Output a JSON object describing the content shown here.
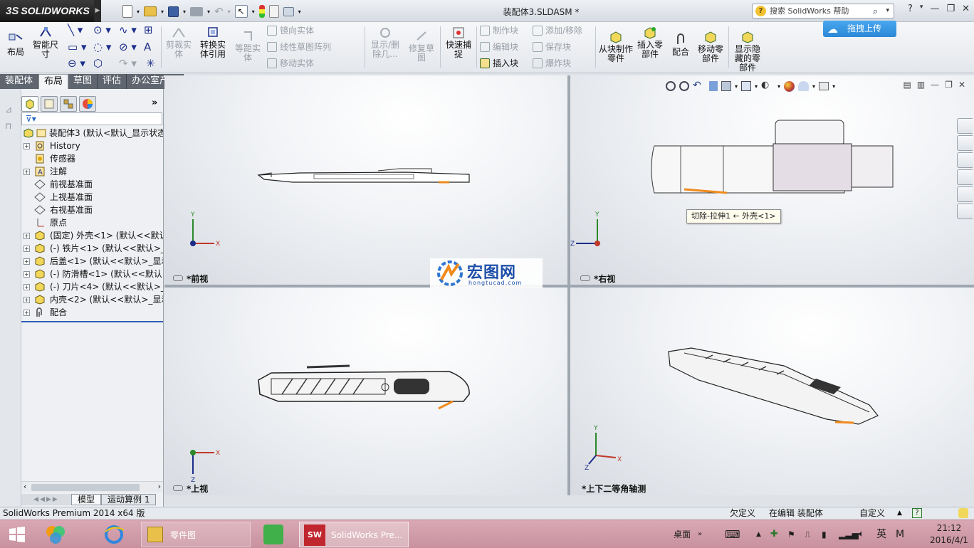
{
  "app": {
    "logo_prefix": "3S",
    "logo_text": "SOLIDWORKS",
    "document_title": "装配体3.SLDASM *",
    "search_placeholder": "搜索 SolidWorks 帮助",
    "upload_label": "拖拽上传",
    "window_controls": [
      "?",
      "▾",
      "—",
      "❐",
      "✕"
    ]
  },
  "ribbon": {
    "layout_label": "布局",
    "smart_dim_label": "智能尺寸",
    "trim_label": "剪裁实体",
    "convert_label": "转换实体引用",
    "offset_label": "等距实体",
    "mirror_label": "镜向实体",
    "linear_pattern_label": "线性草图阵列",
    "move_entity_label": "移动实体",
    "show_delete_label": "显示/删除几...",
    "repair_label": "修复草图",
    "quick_snap_label": "快速捕捉",
    "make_block_label": "制作块",
    "edit_block_label": "编辑块",
    "insert_block_label": "插入块",
    "add_remove_label": "添加/移除",
    "save_block_label": "保存块",
    "explode_block_label": "爆炸块",
    "from_block_label": "从块制作零件",
    "insert_part_label": "插入零部件",
    "mate_label": "配合",
    "move_part_label": "移动零部件",
    "show_hidden_label": "显示隐藏的零部件"
  },
  "tabs": [
    {
      "label": "装配体",
      "active": false
    },
    {
      "label": "布局",
      "active": true
    },
    {
      "label": "草图",
      "active": false
    },
    {
      "label": "评估",
      "active": false
    },
    {
      "label": "办公室产品",
      "active": false
    }
  ],
  "tree": {
    "root": "装配体3  (默认<默认_显示状态",
    "items": [
      {
        "label": "History",
        "icon": "history-icon",
        "expandable": true
      },
      {
        "label": "传感器",
        "icon": "sensor-icon",
        "expandable": false
      },
      {
        "label": "注解",
        "icon": "annotation-icon",
        "expandable": true
      },
      {
        "label": "前视基准面",
        "icon": "plane-icon",
        "expandable": false
      },
      {
        "label": "上视基准面",
        "icon": "plane-icon",
        "expandable": false
      },
      {
        "label": "右视基准面",
        "icon": "plane-icon",
        "expandable": false
      },
      {
        "label": "原点",
        "icon": "origin-icon",
        "expandable": false
      },
      {
        "label": "(固定) 外壳<1> (默认<<默认",
        "icon": "part-icon",
        "expandable": true
      },
      {
        "label": "(-) 铁片<1> (默认<<默认>_",
        "icon": "part-icon",
        "expandable": true
      },
      {
        "label": "后盖<1> (默认<<默认>_显示",
        "icon": "part-icon",
        "expandable": true
      },
      {
        "label": "(-) 防滑槽<1> (默认<<默认>",
        "icon": "part-icon",
        "expandable": true
      },
      {
        "label": "(-) 刀片<4> (默认<<默认>_",
        "icon": "part-icon",
        "expandable": true
      },
      {
        "label": "内壳<2> (默认<<默认>_显示",
        "icon": "part-icon",
        "expandable": true
      },
      {
        "label": "配合",
        "icon": "mates-icon",
        "expandable": true
      }
    ],
    "bottom_tabs": [
      {
        "label": "模型",
        "active": true
      },
      {
        "label": "运动算例 1",
        "active": false
      }
    ]
  },
  "viewports": {
    "front": "*前视",
    "right": "*右视",
    "top": "*上视",
    "iso": "*上下二等角轴测",
    "axis_x": "X",
    "axis_y": "Y",
    "axis_z": "Z",
    "tooltip": "切除-拉伸1 ← 外壳<1>",
    "watermark_cn": "宏图网",
    "watermark_en": "hongtucad.com"
  },
  "statusbar": {
    "product": "SolidWorks Premium 2014 x64 版",
    "definition": "欠定义",
    "editing": "在编辑 装配体",
    "custom": "自定义"
  },
  "taskbar": {
    "folder_label": "零件图",
    "sw_label": "SolidWorks Pre...",
    "desktop_label": "桌面",
    "ime_label": "英",
    "ime_mode": "M",
    "time": "21:12",
    "date": "2016/4/1"
  }
}
